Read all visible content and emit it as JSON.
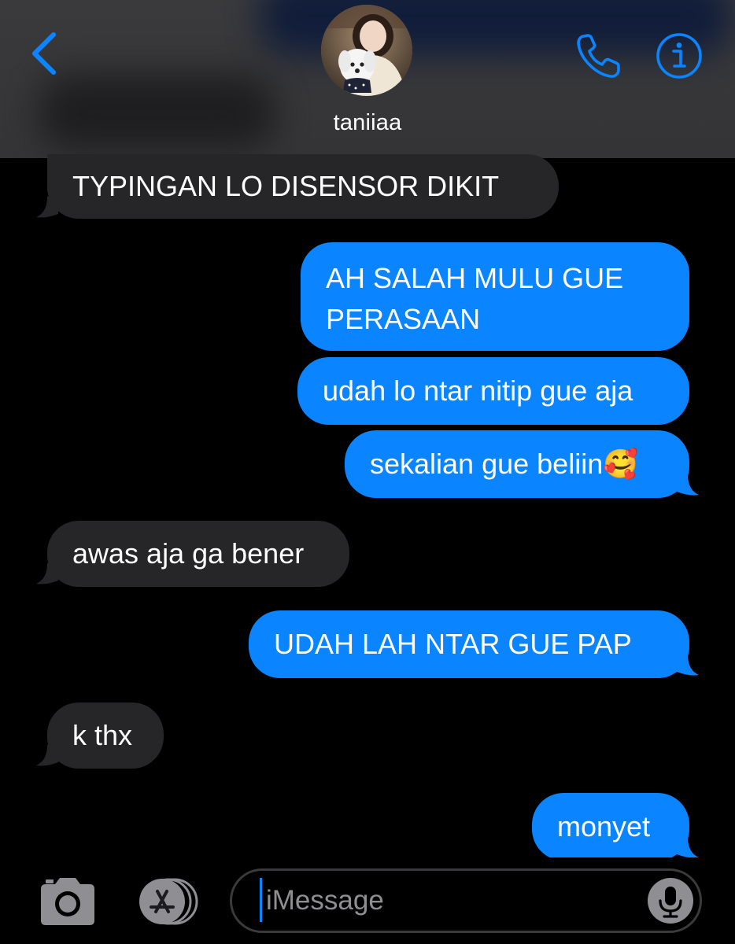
{
  "header": {
    "contact_name": "taniiaa",
    "back_icon": "chevron-left-icon",
    "call_icon": "phone-icon",
    "info_icon": "info-icon",
    "accent_color": "#0a84ff"
  },
  "messages": [
    {
      "direction": "incoming",
      "text": "TYPINGAN LO DISENSOR DIKIT"
    },
    {
      "direction": "outgoing",
      "lines": [
        "AH SALAH MULU GUE",
        "PERASAAN"
      ]
    },
    {
      "direction": "outgoing",
      "text": "udah lo ntar nitip gue aja"
    },
    {
      "direction": "outgoing",
      "text": "sekalian gue beliin🥰"
    },
    {
      "direction": "incoming",
      "text": "awas aja ga bener"
    },
    {
      "direction": "outgoing",
      "text": "UDAH LAH NTAR GUE PAP"
    },
    {
      "direction": "incoming",
      "text": "k thx"
    },
    {
      "direction": "outgoing",
      "text": "monyet"
    }
  ],
  "composer": {
    "placeholder": "iMessage",
    "camera_icon": "camera-icon",
    "apps_icon": "app-store-icon",
    "mic_icon": "microphone-icon"
  },
  "colors": {
    "incoming_bubble": "#262629",
    "outgoing_bubble": "#0a84ff",
    "header_bg": "#3a3a3c"
  }
}
